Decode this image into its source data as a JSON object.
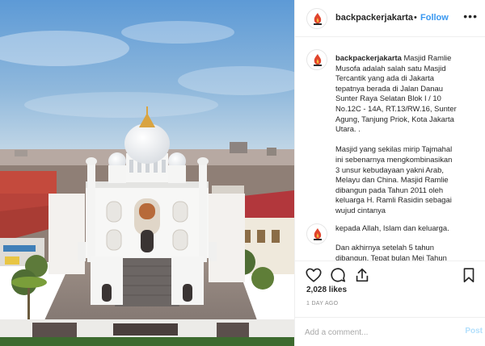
{
  "post": {
    "username": "backpackerjakarta",
    "separator": "•",
    "follow_label": "Follow",
    "more_icon": "more-options-icon"
  },
  "caption": {
    "user": "backpackerjakarta",
    "lines_p1": [
      "Masjid Ramlie",
      "Musofa adalah salah satu Masjid",
      "Tercantik yang ada di Jakarta",
      "tepatnya berada di Jalan Danau",
      "Sunter Raya Selatan Blok I / 10",
      "No.12C - 14A, RT.13/RW.16, Sunter",
      "Agung, Tanjung Priok, Kota Jakarta",
      "Utara. ."
    ],
    "lines_p2": [
      "Masjid yang sekilas mirip Tajmahal",
      "ini sebenarnya mengkombinasikan",
      "3 unsur kebudayaan yakni Arab,",
      "Melayu dan China. Masjid Ramlie",
      "dibangun pada Tahun 2011 oleh",
      "keluarga H. Ramli Rasidin sebagai",
      "wujud cintanya",
      "kepada Allah, Islam dan keluarga."
    ],
    "lines_p3": [
      "Dan akhirnya setelah 5 tahun",
      "dibangun. Tepat bulan Mei Tahun"
    ]
  },
  "actions": {
    "like_icon": "heart-icon",
    "comment_icon": "comment-icon",
    "share_icon": "share-icon",
    "save_icon": "bookmark-icon"
  },
  "likes": "2,028 likes",
  "time_ago": "1 DAY AGO",
  "comment_bar": {
    "placeholder": "Add a comment...",
    "post_label": "Post"
  },
  "colors": {
    "follow_blue": "#3897f0",
    "post_disabled": "#b2dffc",
    "sky_top": "#5d9ad6",
    "sky_bottom": "#c9dbe8",
    "dome_gold": "#d9a441",
    "avatar_red": "#e0442d"
  }
}
